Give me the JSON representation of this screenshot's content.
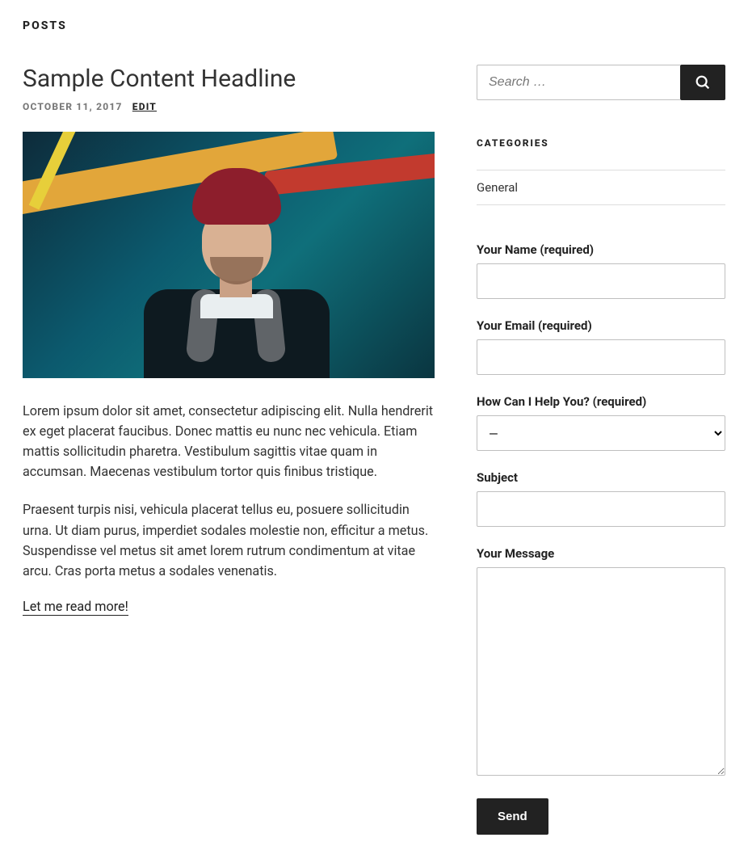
{
  "header": {
    "section_label": "POSTS"
  },
  "post": {
    "title": "Sample Content Headline",
    "date": "OCTOBER 11, 2017",
    "edit_label": "EDIT",
    "paragraphs": [
      "Lorem ipsum dolor sit amet, consectetur adipiscing elit. Nulla hendrerit ex eget placerat faucibus. Donec mattis eu nunc nec vehicula. Etiam mattis sollicitudin pharetra. Vestibulum sagittis vitae quam in accumsan. Maecenas vestibulum tortor quis finibus tristique.",
      "Praesent turpis nisi, vehicula placerat tellus eu, posuere sollicitudin urna. Ut diam purus, imperdiet sodales molestie non, efficitur a metus. Suspendisse vel metus sit amet lorem rutrum condimentum at vitae arcu. Cras porta metus a sodales venenatis."
    ],
    "read_more": "Let me read more!"
  },
  "sidebar": {
    "search": {
      "placeholder": "Search …"
    },
    "categories": {
      "title": "CATEGORIES",
      "items": [
        "General"
      ]
    },
    "form": {
      "name_label": "Your Name (required)",
      "email_label": "Your Email (required)",
      "help_label": "How Can I Help You? (required)",
      "help_selected": "—",
      "subject_label": "Subject",
      "message_label": "Your Message",
      "send_label": "Send"
    }
  }
}
